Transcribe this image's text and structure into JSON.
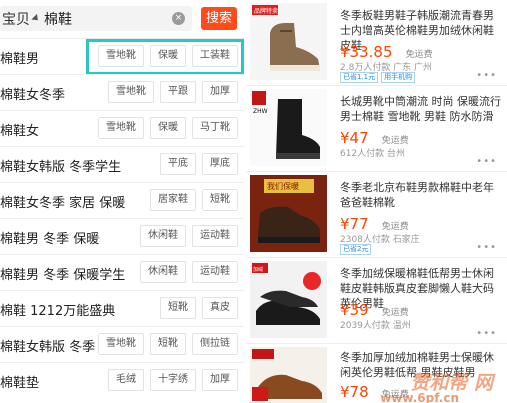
{
  "search": {
    "scope": "宝贝",
    "query": "棉鞋",
    "button": "搜索",
    "clear": "×"
  },
  "suggestions": [
    {
      "text": "棉鞋男",
      "tags": [
        "雪地靴",
        "保暖",
        "工装鞋"
      ]
    },
    {
      "text": "棉鞋女冬季",
      "tags": [
        "雪地靴",
        "平跟",
        "加厚"
      ]
    },
    {
      "text": "棉鞋女",
      "tags": [
        "雪地靴",
        "保暖",
        "马丁靴"
      ]
    },
    {
      "text": "棉鞋女韩版 冬季学生",
      "tags": [
        "平底",
        "厚底"
      ]
    },
    {
      "text": "棉鞋女冬季 家居 保暖",
      "tags": [
        "居家鞋",
        "短靴"
      ]
    },
    {
      "text": "棉鞋男 冬季 保暖",
      "tags": [
        "休闲鞋",
        "运动鞋"
      ]
    },
    {
      "text": "棉鞋男 冬季 保暖学生",
      "tags": [
        "休闲鞋",
        "运动鞋"
      ]
    },
    {
      "text": "棉鞋 1212万能盛典",
      "tags": [
        "短靴",
        "真皮"
      ]
    },
    {
      "text": "棉鞋女韩版 冬季",
      "tags": [
        "雪地靴",
        "短靴",
        "侧拉链"
      ]
    },
    {
      "text": "棉鞋垫",
      "tags": [
        "毛绒",
        "十字绣",
        "加厚"
      ]
    }
  ],
  "products": [
    {
      "title": "冬季板鞋男鞋子韩版潮流青春男士内增高英伦棉鞋男加绒休闲鞋皮鞋",
      "price": "¥33.85",
      "ship": "免运费",
      "meta": "2.8万人付款  广东 广州",
      "badges": [
        "已省1.1元",
        "用手机购"
      ],
      "img_text": "品牌特卖"
    },
    {
      "title": "长城男靴中筒潮流 时尚 保暖流行男士棉鞋 雪地靴 男鞋 防水防滑",
      "price": "¥47",
      "ship": "免运费",
      "meta": "612人付款  台州",
      "badges": [],
      "img_text": "ZHW"
    },
    {
      "title": "冬季老北京布鞋男款棉鞋中老年爸爸鞋棉靴",
      "price": "¥77",
      "ship": "免运费",
      "meta": "2308人付款  石家庄",
      "badges": [
        "已省2元"
      ],
      "img_text": "我们保暖"
    },
    {
      "title": "冬季加绒保暖棉鞋低帮男士休闲鞋皮鞋韩版真皮套脚懒人鞋大码英伦男鞋",
      "price": "¥39",
      "ship": "免运费",
      "meta": "2039人付款  温州",
      "badges": [],
      "img_text": "加绒"
    },
    {
      "title": "冬季加厚加绒加棉鞋男士保暖休闲英伦男鞋低帮 男鞋皮鞋男",
      "price": "¥78",
      "ship": "免运费",
      "meta": "",
      "badges": [],
      "img_text": ""
    }
  ],
  "watermark": "赞和帮 网",
  "watermark_url": "www.6pf.cn"
}
